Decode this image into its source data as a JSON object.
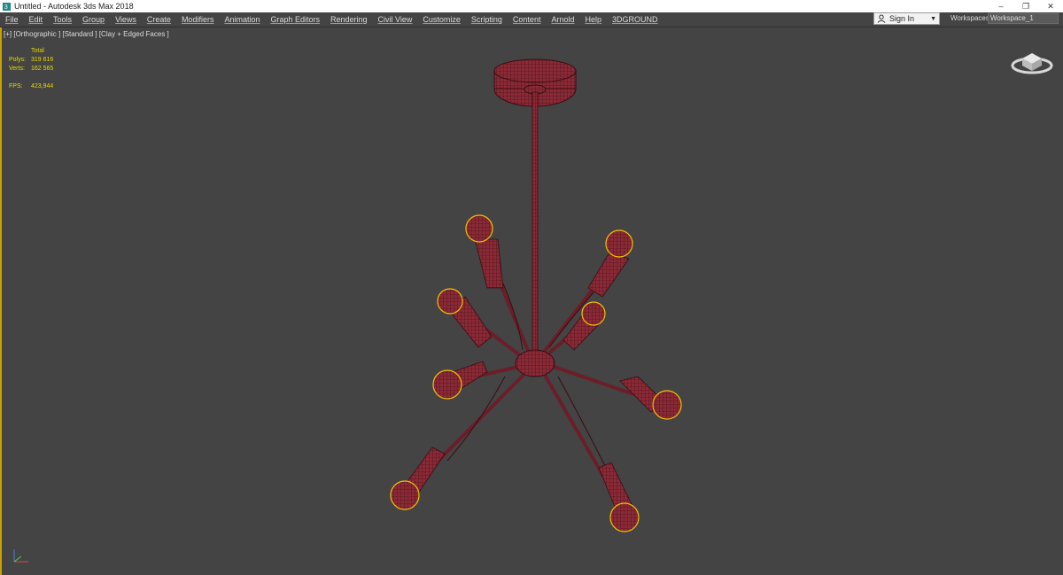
{
  "window": {
    "title": "Untitled - Autodesk 3ds Max 2018",
    "controls": {
      "minimize": "–",
      "maximize": "❐",
      "close": "✕"
    }
  },
  "menu": [
    "File",
    "Edit",
    "Tools",
    "Group",
    "Views",
    "Create",
    "Modifiers",
    "Animation",
    "Graph Editors",
    "Rendering",
    "Civil View",
    "Customize",
    "Scripting",
    "Content",
    "Arnold",
    "Help",
    "3DGROUND"
  ],
  "account": {
    "sign_in": "Sign In"
  },
  "workspaces": {
    "label": "Workspaces:",
    "value": "Workspace_1"
  },
  "viewport": {
    "label": "[+] [Orthographic ] [Standard ] [Clay + Edged Faces ]",
    "stats": {
      "total_label": "Total",
      "polys_label": "Polys:",
      "polys_value": "319 616",
      "verts_label": "Verts:",
      "verts_value": "162 565",
      "fps_label": "FPS:",
      "fps_value": "423,944"
    }
  },
  "colors": {
    "accent": "#c9a200",
    "stats_text": "#e8d800",
    "model_fill": "#8a2a36",
    "model_wire": "#3a0c12",
    "selection": "#f2c200"
  },
  "icons": {
    "viewcube": "viewcube-icon",
    "axis": "axis-tripod-icon",
    "app": "3dsmax-app-icon"
  }
}
